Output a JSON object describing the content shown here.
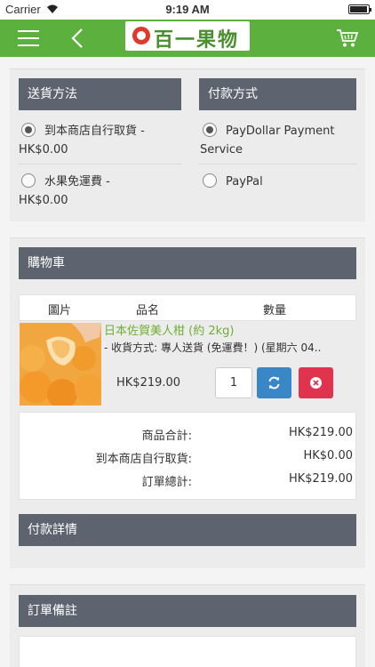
{
  "status_bar": {
    "carrier": "Carrier",
    "time": "9:19 AM"
  },
  "nav": {
    "logo_text": "百一果物"
  },
  "delivery": {
    "header": "送貨方法",
    "options": [
      {
        "line1": "到本商店自行取貨 -",
        "line2": "HK$0.00",
        "selected": true
      },
      {
        "line1": "水果免運費 -",
        "line2": "HK$0.00",
        "selected": false
      }
    ]
  },
  "payment": {
    "header": "付款方式",
    "options": [
      {
        "line1": "PayDollar Payment",
        "line2": "Service",
        "selected": true
      },
      {
        "line1": "PayPal",
        "line2": "",
        "selected": false
      }
    ]
  },
  "cart": {
    "header": "購物車",
    "columns": [
      "圖片",
      "品名",
      "數量"
    ],
    "item": {
      "name": "日本佐賀美人柑 (約 2kg)",
      "detail": "- 收貨方式: 專人送貨 (免運費！) (星期六 04..",
      "price": "HK$219.00",
      "quantity": "1"
    },
    "totals": [
      {
        "label": "商品合計:",
        "value": "HK$219.00"
      },
      {
        "label": "到本商店自行取貨:",
        "value": "HK$0.00"
      },
      {
        "label": "訂單總計:",
        "value": "HK$219.00"
      }
    ]
  },
  "payment_details": {
    "header": "付款詳情"
  },
  "order_notes": {
    "header": "訂單備註"
  },
  "colors": {
    "brand_green": "#5cb03d",
    "header_gray": "#5d6470",
    "refresh_blue": "#3a87c8",
    "remove_red": "#e0344e",
    "product_green": "#6fae31"
  }
}
